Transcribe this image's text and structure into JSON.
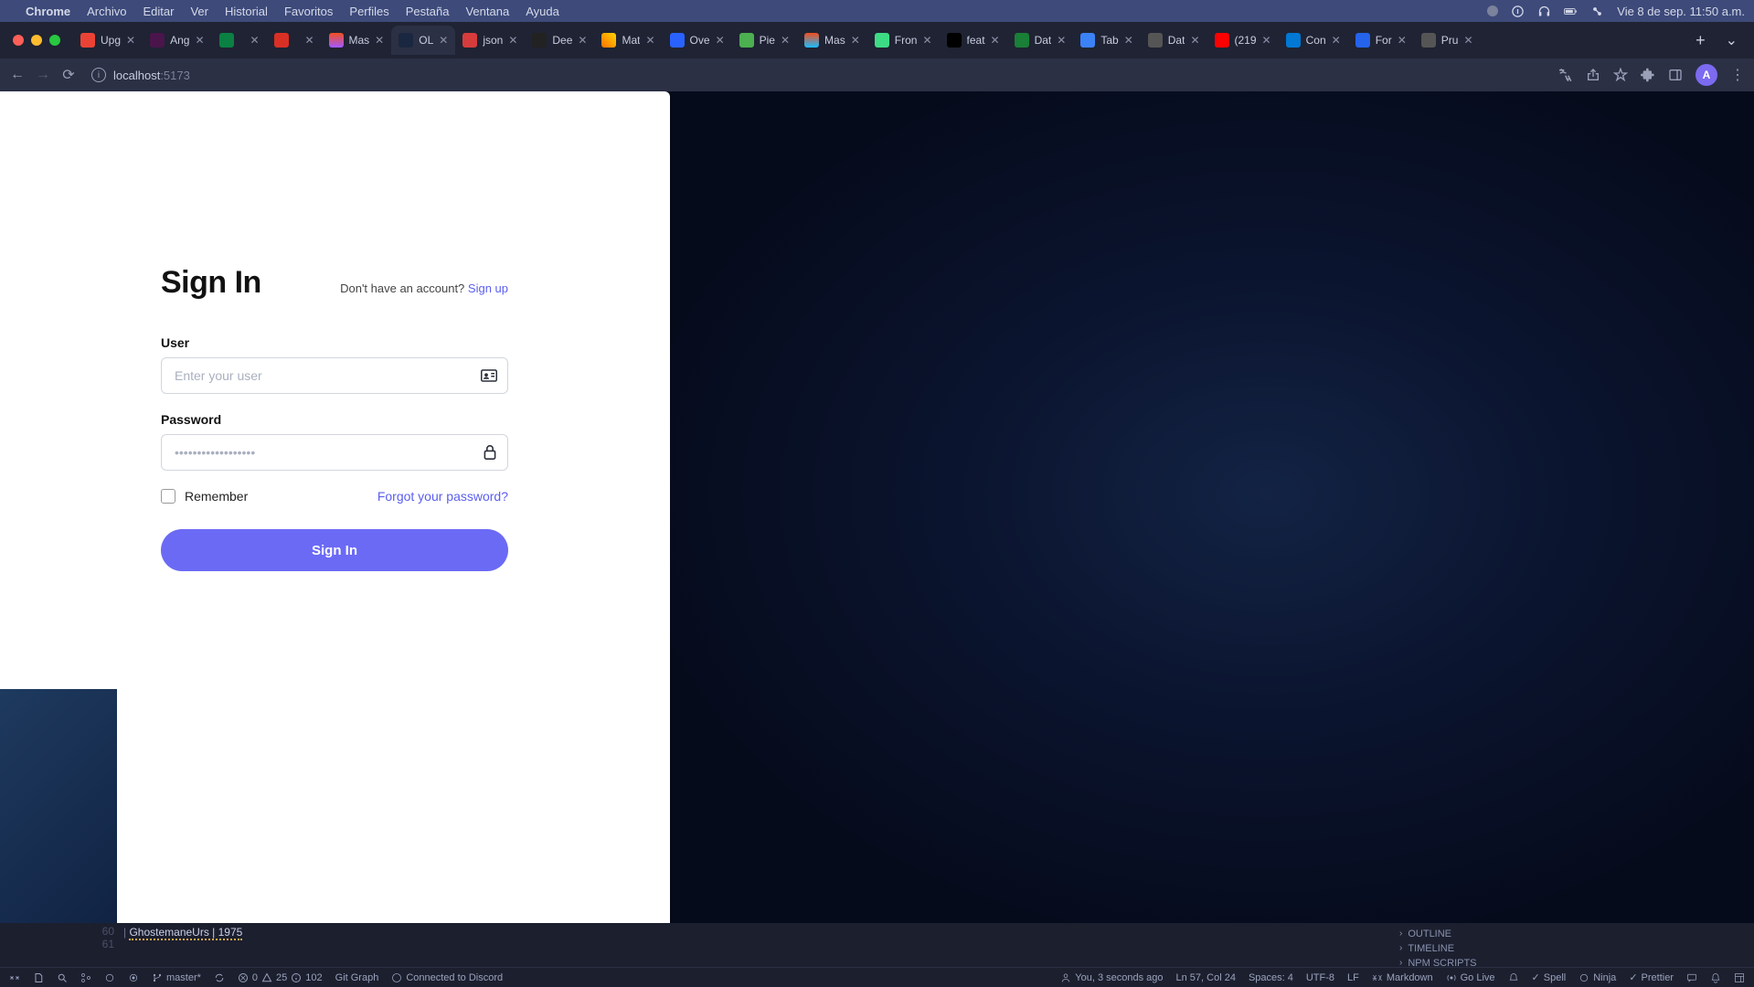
{
  "menubar": {
    "app": "Chrome",
    "items": [
      "Archivo",
      "Editar",
      "Ver",
      "Historial",
      "Favoritos",
      "Perfiles",
      "Pestaña",
      "Ventana",
      "Ayuda"
    ],
    "clock": "Vie 8 de sep.  11:50 a.m."
  },
  "browser": {
    "tabs": [
      {
        "title": "Upg",
        "fav": "fc-gmail"
      },
      {
        "title": "Ang",
        "fav": "fc-slack"
      },
      {
        "title": "",
        "fav": "fc-cam"
      },
      {
        "title": "",
        "fav": "fc-rec"
      },
      {
        "title": "Mas",
        "fav": "fc-figma"
      },
      {
        "title": "OL",
        "fav": "fc-ol",
        "active": true
      },
      {
        "title": "json",
        "fav": "fc-json"
      },
      {
        "title": "Dee",
        "fav": "fc-deep"
      },
      {
        "title": "Mat",
        "fav": "fc-mat"
      },
      {
        "title": "Ove",
        "fav": "fc-ove"
      },
      {
        "title": "Pie",
        "fav": "fc-pie"
      },
      {
        "title": "Mas",
        "fav": "fc-mas"
      },
      {
        "title": "Fron",
        "fav": "fc-fron"
      },
      {
        "title": "feat",
        "fav": "fc-gh"
      },
      {
        "title": "Dat",
        "fav": "fc-dat1"
      },
      {
        "title": "Tab",
        "fav": "fc-tab"
      },
      {
        "title": "Dat",
        "fav": "fc-dat2"
      },
      {
        "title": "(219",
        "fav": "fc-yt"
      },
      {
        "title": "Con",
        "fav": "fc-con"
      },
      {
        "title": "For",
        "fav": "fc-for"
      },
      {
        "title": "Pru",
        "fav": "fc-pru"
      }
    ],
    "url_host": "localhost",
    "url_port": ":5173",
    "avatar_letter": "A"
  },
  "signin": {
    "title": "Sign In",
    "no_account": "Don't have an account? ",
    "signup": "Sign up",
    "user_label": "User",
    "user_placeholder": "Enter your user",
    "password_label": "Password",
    "password_placeholder": "••••••••••••••••••",
    "remember": "Remember",
    "forgot": "Forgot your password?",
    "button": "Sign In"
  },
  "vscode": {
    "lines": [
      {
        "num": "60",
        "text": "GhostemaneUrs | 1975"
      },
      {
        "num": "61",
        "text": ""
      }
    ],
    "panels": [
      "OUTLINE",
      "TIMELINE",
      "NPM SCRIPTS"
    ],
    "status_left": {
      "branch": "master*",
      "err": "0",
      "warn": "25",
      "info": "102",
      "gitgraph": "Git Graph",
      "discord": "Connected to Discord"
    },
    "status_right": {
      "blame": "You, 3 seconds ago",
      "pos": "Ln 57, Col 24",
      "spaces": "Spaces: 4",
      "enc": "UTF-8",
      "eol": "LF",
      "lang": "Markdown",
      "golive": "Go Live",
      "spell": "Spell",
      "ninja": "Ninja",
      "prettier": "Prettier"
    }
  }
}
